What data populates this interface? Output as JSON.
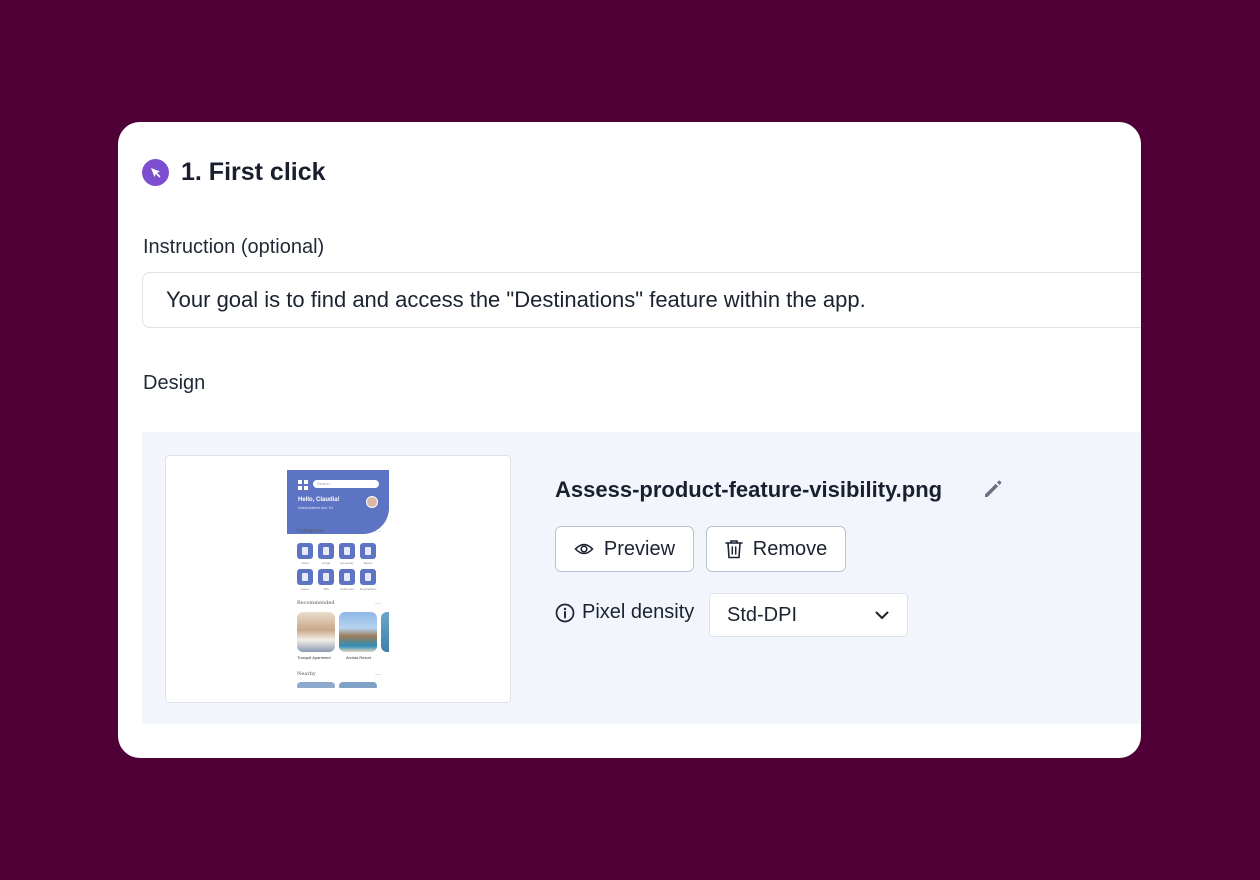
{
  "step": {
    "icon": "cursor-arrow-icon",
    "title": "1. First click"
  },
  "instruction": {
    "label": "Instruction (optional)",
    "value": "Your goal is to find and access the \"Destinations\" feature within the app."
  },
  "design": {
    "label": "Design",
    "file_name": "Assess-product-feature-visibility.png",
    "preview_label": "Preview",
    "remove_label": "Remove",
    "pixel_density_label": "Pixel density",
    "pixel_density_value": "Std-DPI",
    "thumbnail": {
      "search_placeholder": "Search",
      "greeting": "Hello, Claudia!",
      "location": "Independence Ave, NJ",
      "categories_title": "Categories",
      "categories": [
        "Hotel",
        "Lodge",
        "Homestay",
        "Resort",
        "House",
        "Villa",
        "Apartment",
        "Destinations"
      ],
      "recommended_title": "Recommended",
      "recommended": [
        "Tranquil Apartment",
        "Arvista Resort"
      ],
      "nearby_title": "Nearby"
    }
  },
  "colors": {
    "background": "#4f0036",
    "accent": "#7b4fd0",
    "panel": "#f2f6fc",
    "app_primary": "#5d73c4"
  }
}
